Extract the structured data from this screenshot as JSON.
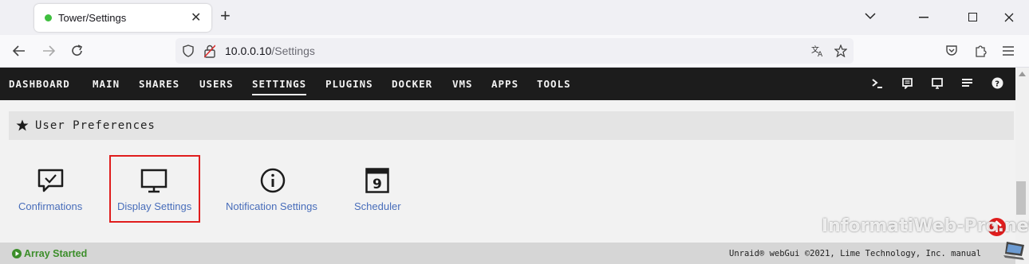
{
  "browser": {
    "tab_title": "Tower/Settings",
    "tab_close": "✕",
    "new_tab": "+",
    "url_host": "10.0.0.10",
    "url_path": "/Settings"
  },
  "menu": {
    "items": [
      "DASHBOARD",
      "MAIN",
      "SHARES",
      "USERS",
      "SETTINGS",
      "PLUGINS",
      "DOCKER",
      "VMS",
      "APPS",
      "TOOLS"
    ],
    "active": "SETTINGS"
  },
  "section": {
    "title": "User Preferences"
  },
  "tiles": {
    "confirmations": "Confirmations",
    "display_settings": "Display Settings",
    "notification_settings": "Notification Settings",
    "scheduler": "Scheduler",
    "scheduler_day": "9"
  },
  "footer": {
    "array_status": "Array Started",
    "copyright": "Unraid® webGui ©2021, Lime Technology, Inc. manual"
  },
  "watermark": "InformatiWeb-Pro.net",
  "colors": {
    "accent_red": "#e01d1d",
    "link_blue": "#486dba",
    "status_green": "#3c8e2a",
    "header_bg": "#1c1c1c"
  },
  "icons": {
    "back": "arrow-left-icon",
    "forward": "arrow-right-icon",
    "reload": "reload-icon",
    "shield": "shield-icon",
    "lock": "lock-icon",
    "translate": "translate-icon",
    "star": "star-icon",
    "pocket": "pocket-icon",
    "extensions": "extensions-icon",
    "menu": "hamburger-icon"
  }
}
